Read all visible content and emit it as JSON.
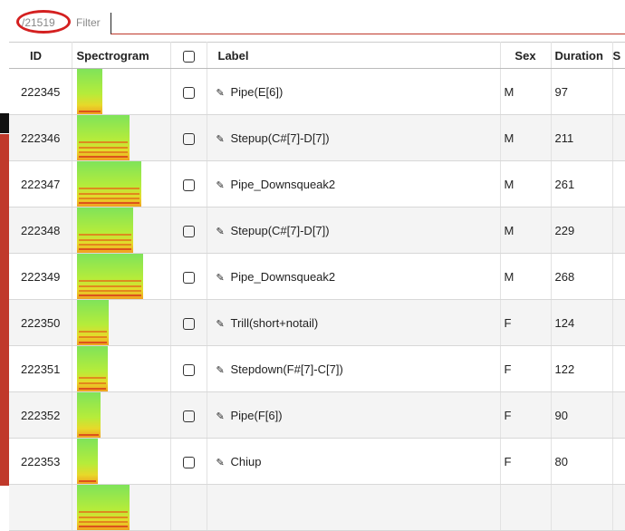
{
  "toolbar": {
    "count": "/21519",
    "filter_label": "Filter",
    "filter_value": ""
  },
  "table": {
    "headers": {
      "id": "ID",
      "spectrogram": "Spectrogram",
      "label": "Label",
      "sex": "Sex",
      "duration": "Duration",
      "extra": "S"
    },
    "rows": [
      {
        "id": "222345",
        "label": "Pipe(E[6])",
        "sex": "M",
        "duration": "97",
        "spec": {
          "w": 0.27,
          "intensity": "low"
        }
      },
      {
        "id": "222346",
        "label": "Stepup(C#[7]-D[7])",
        "sex": "M",
        "duration": "211",
        "spec": {
          "w": 0.56,
          "intensity": "high"
        }
      },
      {
        "id": "222347",
        "label": "Pipe_Downsqueak2",
        "sex": "M",
        "duration": "261",
        "spec": {
          "w": 0.68,
          "intensity": "high"
        }
      },
      {
        "id": "222348",
        "label": "Stepup(C#[7]-D[7])",
        "sex": "M",
        "duration": "229",
        "spec": {
          "w": 0.6,
          "intensity": "high"
        }
      },
      {
        "id": "222349",
        "label": "Pipe_Downsqueak2",
        "sex": "M",
        "duration": "268",
        "spec": {
          "w": 0.7,
          "intensity": "high"
        }
      },
      {
        "id": "222350",
        "label": "Trill(short+notail)",
        "sex": "F",
        "duration": "124",
        "spec": {
          "w": 0.34,
          "intensity": "mid"
        }
      },
      {
        "id": "222351",
        "label": "Stepdown(F#[7]-C[7])",
        "sex": "F",
        "duration": "122",
        "spec": {
          "w": 0.33,
          "intensity": "mid"
        }
      },
      {
        "id": "222352",
        "label": "Pipe(F[6])",
        "sex": "F",
        "duration": "90",
        "spec": {
          "w": 0.25,
          "intensity": "low"
        }
      },
      {
        "id": "222353",
        "label": "Chiup",
        "sex": "F",
        "duration": "80",
        "spec": {
          "w": 0.22,
          "intensity": "low"
        }
      },
      {
        "id": "",
        "label": "",
        "sex": "",
        "duration": "",
        "spec": {
          "w": 0.56,
          "intensity": "high"
        }
      }
    ]
  }
}
